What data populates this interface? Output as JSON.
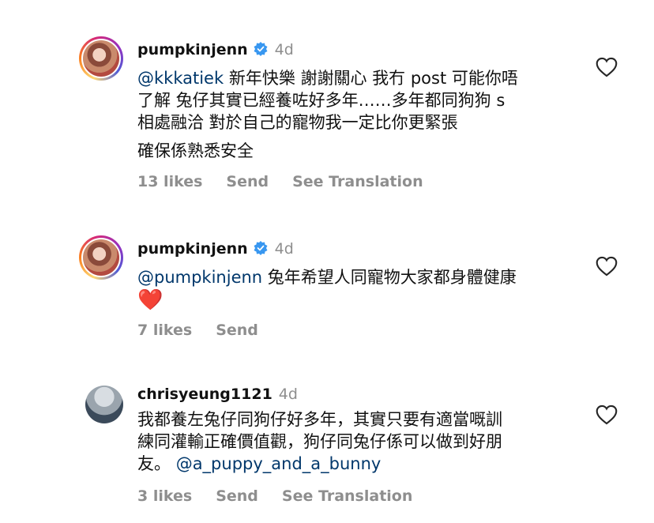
{
  "comments": [
    {
      "username": "pumpkinjenn",
      "time": "4d",
      "mention": "@kkkatiek",
      "line1": " 新年快樂 謝謝關心 我冇 post 可能你唔",
      "line2": "了解 兔仔其實已經養咗好多年……多年都同狗狗 s",
      "line3": "相處融洽 對於自己的寵物我一定比你更緊張",
      "line4": "確保係熟悉安全",
      "likes": "13 likes",
      "send": "Send",
      "translate": "See Translation"
    },
    {
      "username": "pumpkinjenn",
      "time": "4d",
      "mention": "@pumpkinjenn",
      "line1": " 兔年希望人同寵物大家都身體健康",
      "emoji": "❤️",
      "likes": "7 likes",
      "send": "Send"
    },
    {
      "username": "chrisyeung1121",
      "time": "4d",
      "line1": "我都養左兔仔同狗仔好多年，其實只要有適當嘅訓",
      "line2": "練同灌輸正確價值觀，狗仔同兔仔係可以做到好朋",
      "line3": "友。 ",
      "mention": "@a_puppy_and_a_bunny",
      "likes": "3 likes",
      "send": "Send",
      "translate": "See Translation"
    }
  ],
  "colors": {
    "mention": "#00376b",
    "muted": "#8e8e8e",
    "verified": "#3897f0"
  }
}
